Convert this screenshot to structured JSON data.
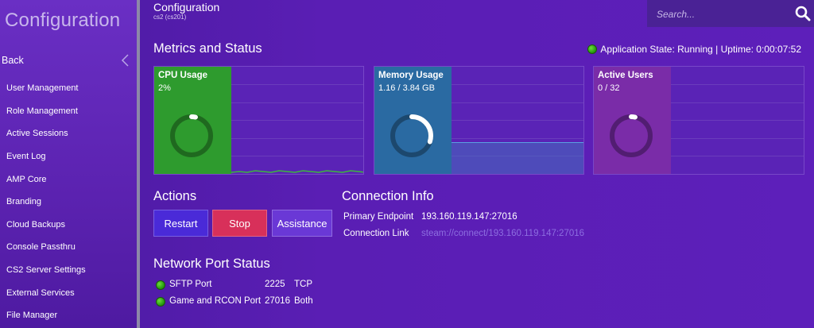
{
  "app": {
    "title": "Configuration"
  },
  "sidebar": {
    "back_label": "Back",
    "items": [
      {
        "label": "User Management"
      },
      {
        "label": "Role Management"
      },
      {
        "label": "Active Sessions"
      },
      {
        "label": "Event Log"
      },
      {
        "label": "AMP Core"
      },
      {
        "label": "Branding"
      },
      {
        "label": "Cloud Backups"
      },
      {
        "label": "Console Passthru"
      },
      {
        "label": "CS2 Server Settings"
      },
      {
        "label": "External Services"
      },
      {
        "label": "File Manager"
      }
    ]
  },
  "header": {
    "title": "Configuration",
    "subtitle": "cs2 (cs201)"
  },
  "search": {
    "placeholder": "Search..."
  },
  "metrics": {
    "title": "Metrics and Status",
    "app_state": "Application State: Running | Uptime: 0:00:07:52",
    "cards": [
      {
        "label": "CPU Usage",
        "value": "2%",
        "fraction": 0.02,
        "color": "#2e9b2e"
      },
      {
        "label": "Memory Usage",
        "value": "1.16 / 3.84 GB",
        "fraction": 0.3,
        "color": "#2a6aa2"
      },
      {
        "label": "Active Users",
        "value": "0 / 32",
        "fraction": 0.0,
        "color": "#7a2ca8"
      }
    ]
  },
  "actions": {
    "title": "Actions",
    "restart_label": "Restart",
    "stop_label": "Stop",
    "assistance_label": "Assistance",
    "restart_color": "#4a2ad8",
    "stop_color": "#d8305a",
    "assistance_color": "#6a38d6"
  },
  "connection": {
    "title": "Connection Info",
    "endpoint_label": "Primary Endpoint",
    "endpoint_value": "193.160.119.147:27016",
    "link_label": "Connection Link",
    "link_value": "steam://connect/193.160.119.147:27016"
  },
  "ports": {
    "title": "Network Port Status",
    "rows": [
      {
        "name": "SFTP Port",
        "port": "2225",
        "protocol": "TCP"
      },
      {
        "name": "Game and RCON Port",
        "port": "27016",
        "protocol": "Both"
      }
    ]
  }
}
